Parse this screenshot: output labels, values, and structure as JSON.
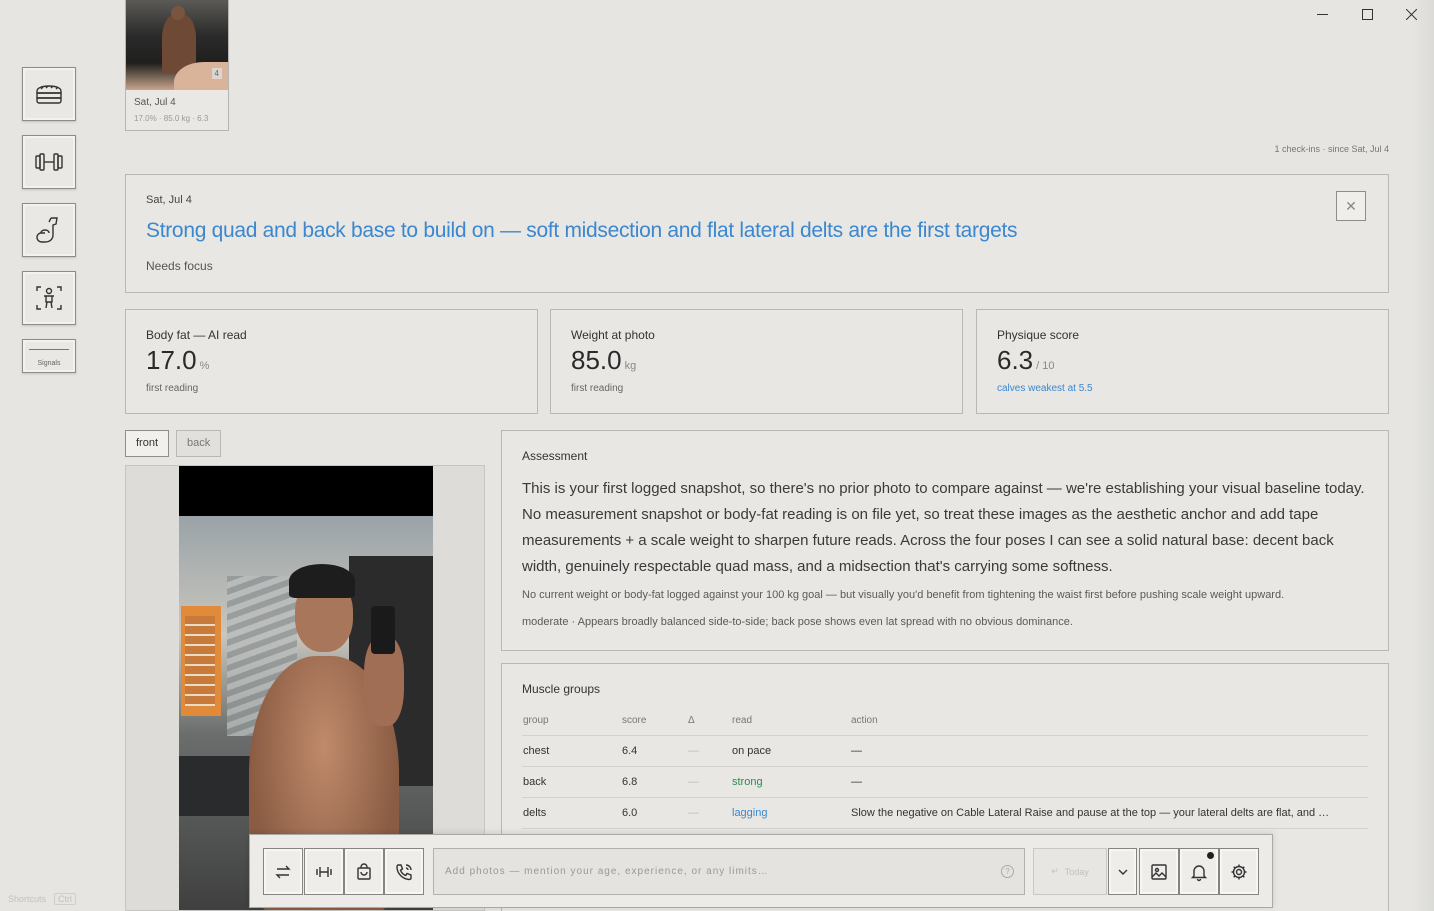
{
  "window": {
    "minimize": "minimize",
    "maximize": "maximize",
    "close": "close"
  },
  "rail": {
    "icons": [
      "bread-icon",
      "dumbbell-icon",
      "flexed-arm-icon",
      "body-scan-icon"
    ],
    "signals_label": "Signals"
  },
  "shortcuts": {
    "label": "Shortcuts",
    "key": "Ctrl"
  },
  "checkin_thumb": {
    "count": "4",
    "date": "Sat, Jul 4",
    "meta": "17.0% · 85.0 kg · 6.3"
  },
  "history_summary": "1 check-ins · since Sat, Jul 4",
  "hero": {
    "date": "Sat, Jul 4",
    "headline": "Strong quad and back base to build on — soft midsection and flat lateral delts are the first targets",
    "status": "Needs focus",
    "close_glyph": "✕"
  },
  "metrics": [
    {
      "label": "Body fat — AI read",
      "value": "17.0",
      "unit": "%",
      "note": "first reading"
    },
    {
      "label": "Weight at photo",
      "value": "85.0",
      "unit": "kg",
      "note": "first reading"
    },
    {
      "label": "Physique score",
      "value": "6.3",
      "unit": "/ 10",
      "note": "calves weakest at 5.5"
    }
  ],
  "photo_tabs": {
    "front": "front",
    "back": "back",
    "active": "front"
  },
  "assessment": {
    "title": "Assessment",
    "body": "This is your first logged snapshot, so there's no prior photo to compare against — we're establishing your visual baseline today. No measurement snapshot or body-fat reading is on file yet, so treat these images as the aesthetic anchor and add tape measurements + a scale weight to sharpen future reads. Across the four poses I can see a solid natural base: decent back width, genuinely respectable quad mass, and a midsection that's carrying some softness.",
    "goal_note": "No current weight or body-fat logged against your 100 kg goal — but visually you'd benefit from tightening the waist first before pushing scale weight upward.",
    "balance_note": "moderate · Appears broadly balanced side-to-side; back pose shows even lat spread with no obvious dominance."
  },
  "muscle_groups": {
    "title": "Muscle groups",
    "columns": {
      "group": "group",
      "score": "score",
      "delta": "Δ",
      "read": "read",
      "action": "action"
    },
    "rows": [
      {
        "group": "chest",
        "score": "6.4",
        "delta": "—",
        "read": "on pace",
        "action": "—"
      },
      {
        "group": "back",
        "score": "6.8",
        "delta": "—",
        "read": "strong",
        "action": "—"
      },
      {
        "group": "delts",
        "score": "6.0",
        "delta": "—",
        "read": "lagging",
        "action": "Slow the negative on Cable Lateral Raise and pause at the top — your lateral delts are flat, and …"
      }
    ]
  },
  "composer": {
    "placeholder": "Add photos — mention your age, experience, or any limits…",
    "help_glyph": "?",
    "today_label": "Today",
    "buttons": [
      "swap-icon",
      "barbell-icon",
      "shopping-bag-icon",
      "phone-call-icon",
      "chevron-down-icon",
      "image-icon",
      "bell-icon",
      "gear-icon"
    ]
  }
}
